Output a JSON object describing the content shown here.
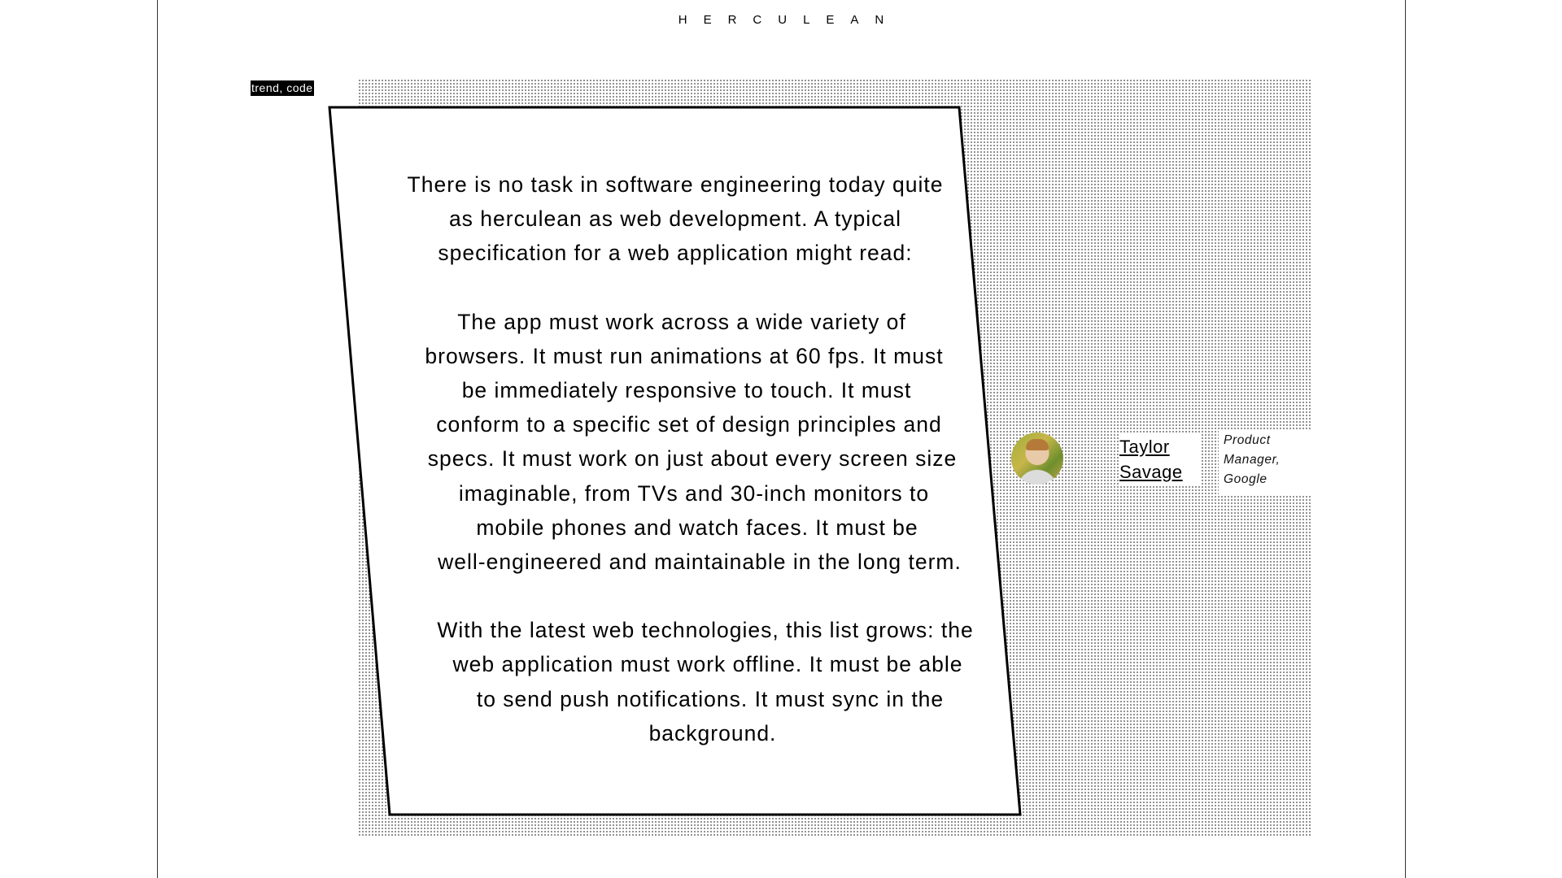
{
  "header": {
    "brand": "HERCULEAN"
  },
  "tag": {
    "label": "trend, code"
  },
  "quote": {
    "paragraphs": [
      [
        "There is no task in software engineering today quite",
        "as herculean as web development. A typical",
        "specification for a web application might read:"
      ],
      [
        "The app must work across a wide variety of",
        "browsers. It must run animations at 60 fps. It must",
        "be immediately responsive to touch. It must",
        "conform to a specific set of design principles and",
        "specs. It must work on just about every screen size",
        "imaginable, from TVs and 30-inch monitors to",
        "mobile phones and watch faces. It must be",
        "well-engineered and maintainable in the long term."
      ],
      [
        "With the latest web technologies, this list grows: the",
        "web application must work offline. It must be able",
        "to send push notifications. It must sync in the",
        "background."
      ]
    ]
  },
  "author": {
    "first_name": "Taylor",
    "last_name": "Savage",
    "role_line1": "Product",
    "role_line2": "Manager,",
    "role_line3": "Google"
  }
}
